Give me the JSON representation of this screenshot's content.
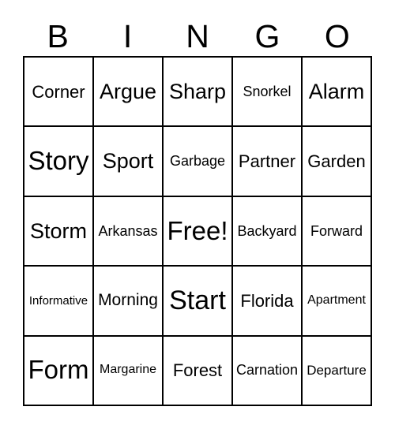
{
  "header": {
    "letters": [
      "B",
      "I",
      "N",
      "G",
      "O"
    ]
  },
  "grid": {
    "rows": [
      [
        {
          "label": "Corner",
          "size": "fs-sm"
        },
        {
          "label": "Argue",
          "size": "fs-md"
        },
        {
          "label": "Sharp",
          "size": "fs-md"
        },
        {
          "label": "Snorkel",
          "size": "fs-xs"
        },
        {
          "label": "Alarm",
          "size": "fs-md"
        }
      ],
      [
        {
          "label": "Story",
          "size": "fs-lg"
        },
        {
          "label": "Sport",
          "size": "fs-md"
        },
        {
          "label": "Garbage",
          "size": "fs-xs"
        },
        {
          "label": "Partner",
          "size": "fs-sm"
        },
        {
          "label": "Garden",
          "size": "fs-sm"
        }
      ],
      [
        {
          "label": "Storm",
          "size": "fs-md"
        },
        {
          "label": "Arkansas",
          "size": "fs-xs"
        },
        {
          "label": "Free!",
          "size": "fs-lg"
        },
        {
          "label": "Backyard",
          "size": "fs-xs"
        },
        {
          "label": "Forward",
          "size": "fs-xs"
        }
      ],
      [
        {
          "label": "Informative",
          "size": "fs-xxs"
        },
        {
          "label": "Morning",
          "size": "fs-sm"
        },
        {
          "label": "Start",
          "size": "fs-xl"
        },
        {
          "label": "Florida",
          "size": "fs-sm"
        },
        {
          "label": "Apartment",
          "size": "fs-xxs"
        }
      ],
      [
        {
          "label": "Form",
          "size": "fs-xl"
        },
        {
          "label": "Margarine",
          "size": "fs-xxs"
        },
        {
          "label": "Forest",
          "size": "fs-sm"
        },
        {
          "label": "Carnation",
          "size": "fs-xs"
        },
        {
          "label": "Departure",
          "size": "fs-xs"
        }
      ]
    ]
  },
  "colors": {
    "background": "#ffffff",
    "text": "#000000",
    "grid_line": "#000000"
  }
}
